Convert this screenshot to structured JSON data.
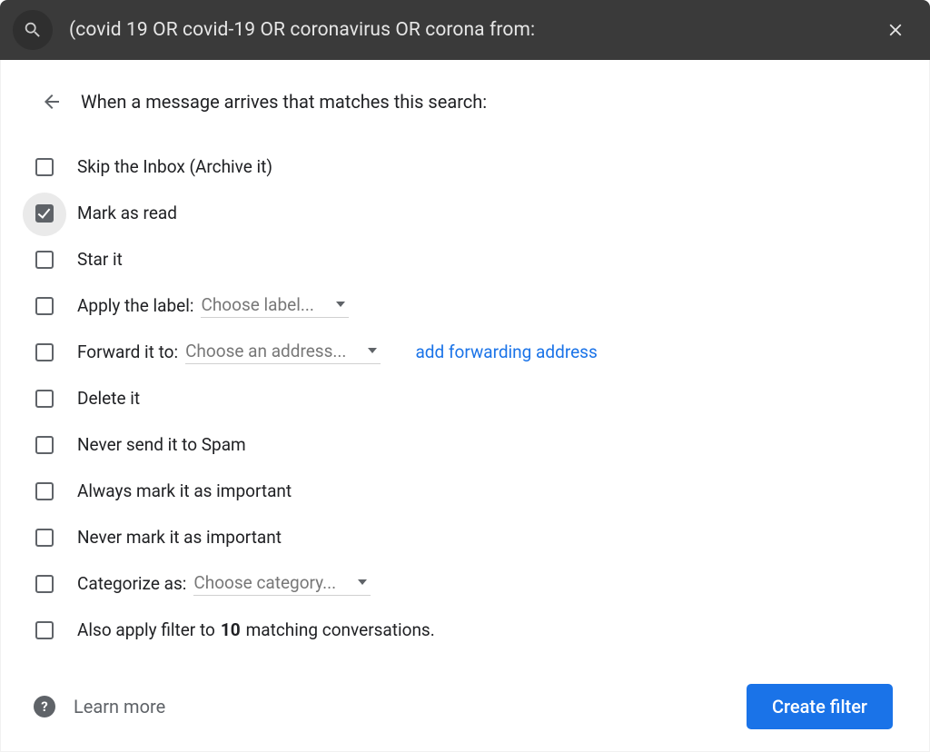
{
  "search": {
    "query": "(covid 19 OR covid-19 OR coronavirus OR corona from:"
  },
  "header": {
    "title": "When a message arrives that matches this search:"
  },
  "options": {
    "skip_inbox": "Skip the Inbox (Archive it)",
    "mark_read": "Mark as read",
    "star_it": "Star it",
    "apply_label": "Apply the label:",
    "apply_label_dropdown": "Choose label...",
    "forward_to": "Forward it to:",
    "forward_to_dropdown": "Choose an address...",
    "forward_link": "add forwarding address",
    "delete_it": "Delete it",
    "never_spam": "Never send it to Spam",
    "always_important": "Always mark it as important",
    "never_important": "Never mark it as important",
    "categorize_as": "Categorize as:",
    "categorize_dropdown": "Choose category...",
    "also_apply_pre": "Also apply filter to ",
    "also_apply_count": "10",
    "also_apply_post": " matching conversations."
  },
  "footer": {
    "learn_more": "Learn more",
    "create_filter": "Create filter"
  },
  "colors": {
    "accent": "#1a73e8",
    "topbar": "#3a3a3a"
  }
}
